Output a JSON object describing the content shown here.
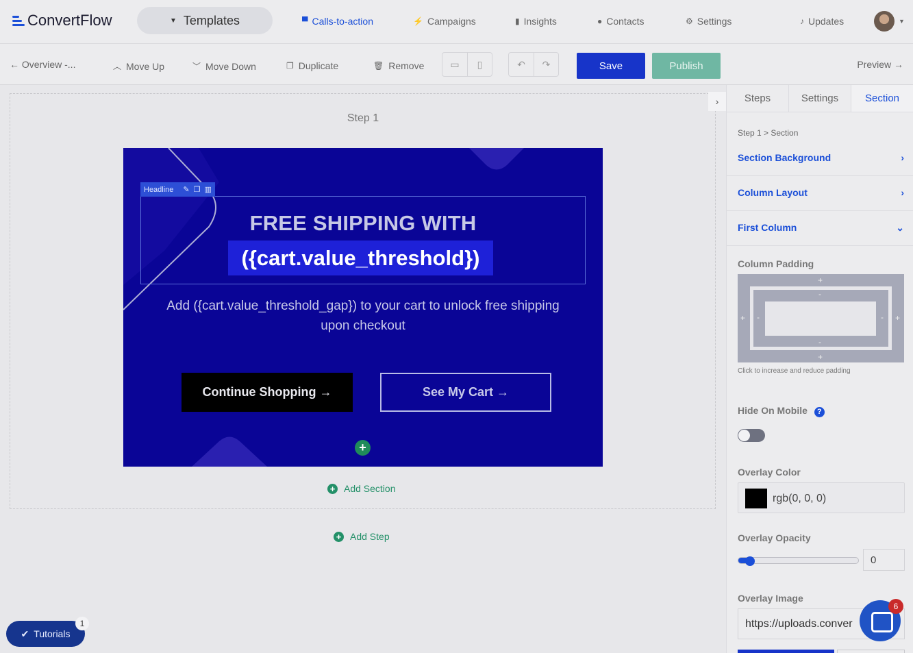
{
  "brand": {
    "name": "ConvertFlow",
    "accent": "#1b4fd8"
  },
  "topnav": {
    "templates": "Templates",
    "links": [
      "Calls-to-action",
      "Campaigns",
      "Insights",
      "Contacts",
      "Settings"
    ],
    "updates": "Updates"
  },
  "toolbar": {
    "back": "← Overview -...",
    "move_up": "Move Up",
    "move_down": "Move Down",
    "duplicate": "Duplicate",
    "remove": "Remove",
    "save": "Save",
    "publish": "Publish",
    "preview": "Preview →"
  },
  "canvas": {
    "step_title": "Step 1",
    "headline_tag": "Headline",
    "headline_line1": "FREE SHIPPING WITH",
    "headline_line2": "({cart.value_threshold})",
    "subtext": "Add ({cart.value_threshold_gap}) to your cart to unlock free shipping upon checkout",
    "button_primary": "Continue Shopping →",
    "button_secondary": "See My Cart →",
    "add_section": "Add Section",
    "add_step": "Add Step",
    "section_bg": "#0a0596"
  },
  "tutorials": {
    "label": "Tutorials",
    "badge": "1"
  },
  "panel": {
    "tabs": [
      "Steps",
      "Settings",
      "Section"
    ],
    "breadcrumb": "Step 1 > Section",
    "accordions": [
      "Section Background",
      "Column Layout",
      "First Column"
    ],
    "column_padding_label": "Column Padding",
    "padding_hint": "Click to increase and reduce padding",
    "hide_on_mobile_label": "Hide On Mobile",
    "hide_on_mobile": false,
    "overlay_color_label": "Overlay Color",
    "overlay_color": "rgb(0, 0, 0)",
    "overlay_opacity_label": "Overlay Opacity",
    "overlay_opacity": "0",
    "overlay_image_label": "Overlay Image",
    "overlay_image": "https://uploads.conver"
  },
  "chat": {
    "badge": "6"
  }
}
